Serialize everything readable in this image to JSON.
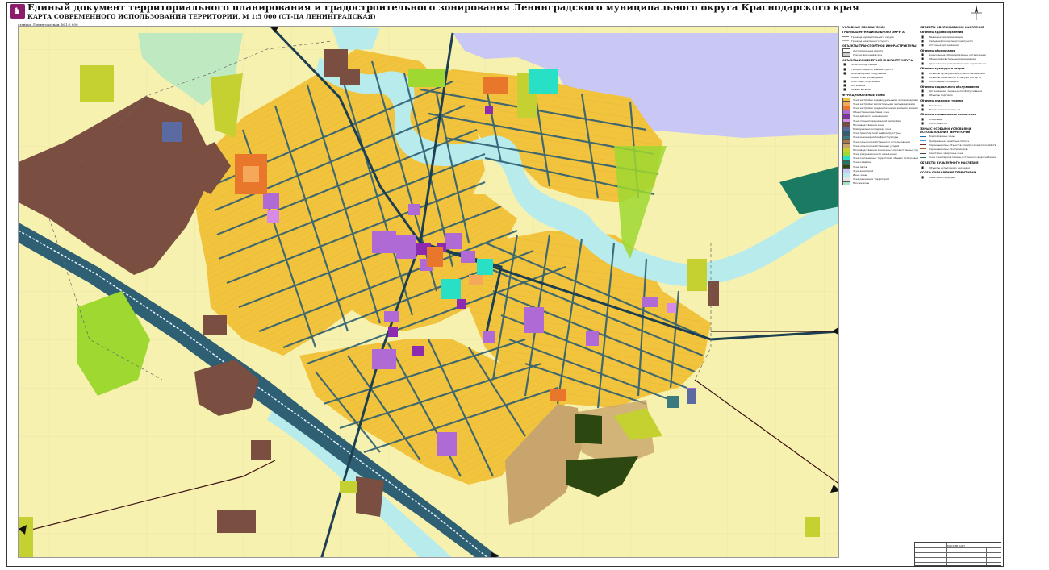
{
  "header": {
    "title": "Единый документ территориального планирования и градостроительного зонирования Ленинградского муниципального округа Краснодарского края",
    "subtitle": "КАРТА СОВРЕМЕННОГО ИСПОЛЬЗОВАНИЯ ТЕРРИТОРИИ, М 1:5 000 (СТ-ЦА ЛЕНИНГРАДСКАЯ)",
    "scale_note": "станица Ленинградская, М 1:5 000"
  },
  "colors": {
    "residential": "#f2c43d",
    "agricultural": "#f7f1b0",
    "roads": "#2e5f73",
    "river": "#b8ecec",
    "reservoir": "#c9c8f5",
    "industrial": "#7a4f41",
    "public": "#b06ad6",
    "commercial": "#f08a20",
    "green": "#c4d130",
    "recreation": "#9fd830",
    "special": "#1b7a62",
    "forest": "#2d4710",
    "sand": "#c8a56c"
  },
  "legend": {
    "col1": [
      {
        "type": "section",
        "text": "УСЛОВНЫЕ ОБОЗНАЧЕНИЯ"
      },
      {
        "type": "section",
        "text": "ГРАНИЦЫ МУНИЦИПАЛЬНОГО ОКРУГА"
      },
      {
        "type": "line",
        "color": "#888888",
        "text": "Граница муниципального округа"
      },
      {
        "type": "line",
        "color": "#aaaaaa",
        "text": "Граница населенного пункта"
      },
      {
        "type": "section",
        "text": "ОБЪЕКТЫ ТРАНСПОРТНОЙ ИНФРАСТРУКТУРЫ"
      },
      {
        "type": "swatch",
        "color": "#ffffff",
        "text": "Автомобильные дороги"
      },
      {
        "type": "swatch",
        "color": "#cccccc",
        "text": "Улично-дорожная сеть"
      },
      {
        "type": "section",
        "text": "ОБЪЕКТЫ ИНЖЕНЕРНОЙ ИНФРАСТРУКТУРЫ"
      },
      {
        "type": "icon",
        "text": "Электроподстанции"
      },
      {
        "type": "icon",
        "text": "Газораспределительные пункты"
      },
      {
        "type": "icon",
        "text": "Водозаборные сооружения"
      },
      {
        "type": "line",
        "color": "#5a1a1a",
        "text": "Линии электропередачи"
      },
      {
        "type": "icon",
        "text": "Очистные сооружения"
      },
      {
        "type": "icon",
        "text": "Котельные"
      },
      {
        "type": "icon",
        "text": "Объекты связи"
      },
      {
        "type": "section",
        "text": "ФУНКЦИОНАЛЬНЫЕ ЗОНЫ"
      },
      {
        "type": "swatch",
        "color": "#f2c43d",
        "text": "Зона застройки индивидуальными жилыми домами"
      },
      {
        "type": "swatch",
        "color": "#f6a85a",
        "text": "Зона застройки малоэтажными жилыми домами"
      },
      {
        "type": "swatch",
        "color": "#e9772b",
        "text": "Зона застройки среднеэтажными жилыми домами"
      },
      {
        "type": "swatch",
        "color": "#b06ad6",
        "text": "Общественно-деловые зоны"
      },
      {
        "type": "swatch",
        "color": "#8c2bb0",
        "text": "Зона делового назначения"
      },
      {
        "type": "swatch",
        "color": "#d88be6",
        "text": "Зона специализированной застройки"
      },
      {
        "type": "swatch",
        "color": "#7a4f41",
        "text": "Производственная зона"
      },
      {
        "type": "swatch",
        "color": "#5b6aa0",
        "text": "Коммунально-складская зона"
      },
      {
        "type": "swatch",
        "color": "#2e5f73",
        "text": "Зона транспортной инфраструктуры"
      },
      {
        "type": "swatch",
        "color": "#3c7a7f",
        "text": "Зона инженерной инфраструктуры"
      },
      {
        "type": "swatch",
        "color": "#a8784a",
        "text": "Зона сельскохозяйственного использования"
      },
      {
        "type": "swatch",
        "color": "#c8a56c",
        "text": "Зона сельскохозяйственных угодий"
      },
      {
        "type": "swatch",
        "color": "#c4d130",
        "text": "Производственная зона сельскохозяйственных предприятий"
      },
      {
        "type": "swatch",
        "color": "#9fd830",
        "text": "Зоны рекреационного назначения"
      },
      {
        "type": "swatch",
        "color": "#27e0c5",
        "text": "Зона озелененных территорий общего пользования"
      },
      {
        "type": "swatch",
        "color": "#1b7a62",
        "text": "Зона кладбищ"
      },
      {
        "type": "swatch",
        "color": "#2d4710",
        "text": "Зона лесов"
      },
      {
        "type": "swatch",
        "color": "#c9c8f5",
        "text": "Зона акваторий"
      },
      {
        "type": "swatch",
        "color": "#b8ecec",
        "text": "Иные зоны"
      },
      {
        "type": "swatch",
        "color": "#e6e6e6",
        "text": "Зона режимных территорий"
      },
      {
        "type": "swatch",
        "color": "#a6e6c8",
        "text": "Прочие зоны"
      }
    ],
    "col2": [
      {
        "type": "section",
        "text": "ОБЪЕКТЫ ОБСЛУЖИВАНИЯ НАСЕЛЕНИЯ"
      },
      {
        "type": "section",
        "text": "Объекты здравоохранения"
      },
      {
        "type": "icon",
        "text": "Медицинские организации"
      },
      {
        "type": "icon",
        "text": "Фельдшерско-акушерские пункты"
      },
      {
        "type": "icon",
        "text": "Аптечные организации"
      },
      {
        "type": "section",
        "text": "Объекты образования"
      },
      {
        "type": "icon",
        "text": "Дошкольные образовательные организации"
      },
      {
        "type": "icon",
        "text": "Общеобразовательные организации"
      },
      {
        "type": "icon",
        "text": "Организации дополнительного образования"
      },
      {
        "type": "section",
        "text": "Объекты культуры и спорта"
      },
      {
        "type": "icon",
        "text": "Объекты культурно-досугового назначения"
      },
      {
        "type": "icon",
        "text": "Объекты физической культуры и спорта"
      },
      {
        "type": "icon",
        "text": "Спортивные площадки"
      },
      {
        "type": "section",
        "text": "Объекты социального обслуживания"
      },
      {
        "type": "icon",
        "text": "Организации социального обслуживания"
      },
      {
        "type": "icon",
        "text": "Объекты торговли"
      },
      {
        "type": "section",
        "text": "Объекты отдыха и туризма"
      },
      {
        "type": "icon",
        "text": "Гостиницы"
      },
      {
        "type": "icon",
        "text": "Места массового отдыха"
      },
      {
        "type": "section",
        "text": "Объекты специального назначения"
      },
      {
        "type": "icon",
        "text": "Кладбища"
      },
      {
        "type": "icon",
        "text": "Полигоны ТКО"
      },
      {
        "type": "section",
        "text": "ЗОНЫ С ОСОБЫМИ УСЛОВИЯМИ ИСПОЛЬЗОВАНИЯ ТЕРРИТОРИЙ"
      },
      {
        "type": "line",
        "color": "#1c6ea8",
        "text": "Водоохранные зоны"
      },
      {
        "type": "line",
        "color": "#3c9ad6",
        "text": "Прибрежные защитные полосы"
      },
      {
        "type": "line",
        "color": "#7a2a2a",
        "text": "Охранные зоны объектов электросетевого хозяйства"
      },
      {
        "type": "line",
        "color": "#a85a2a",
        "text": "Охранные зоны газопроводов"
      },
      {
        "type": "line",
        "color": "#444444",
        "text": "Санитарно-защитные зоны"
      },
      {
        "type": "line",
        "color": "#2a7a4a",
        "text": "Зоны санитарной охраны источников водоснабжения"
      },
      {
        "type": "section",
        "text": "ОБЪЕКТЫ КУЛЬТУРНОГО НАСЛЕДИЯ"
      },
      {
        "type": "icon",
        "text": "Объекты культурного наследия"
      },
      {
        "type": "section",
        "text": "ОСОБО ОХРАНЯЕМЫЕ ТЕРРИТОРИИ"
      },
      {
        "type": "icon",
        "text": "Памятники природы"
      }
    ]
  },
  "title_block": {
    "label": "МАССИВ КАРТ"
  }
}
